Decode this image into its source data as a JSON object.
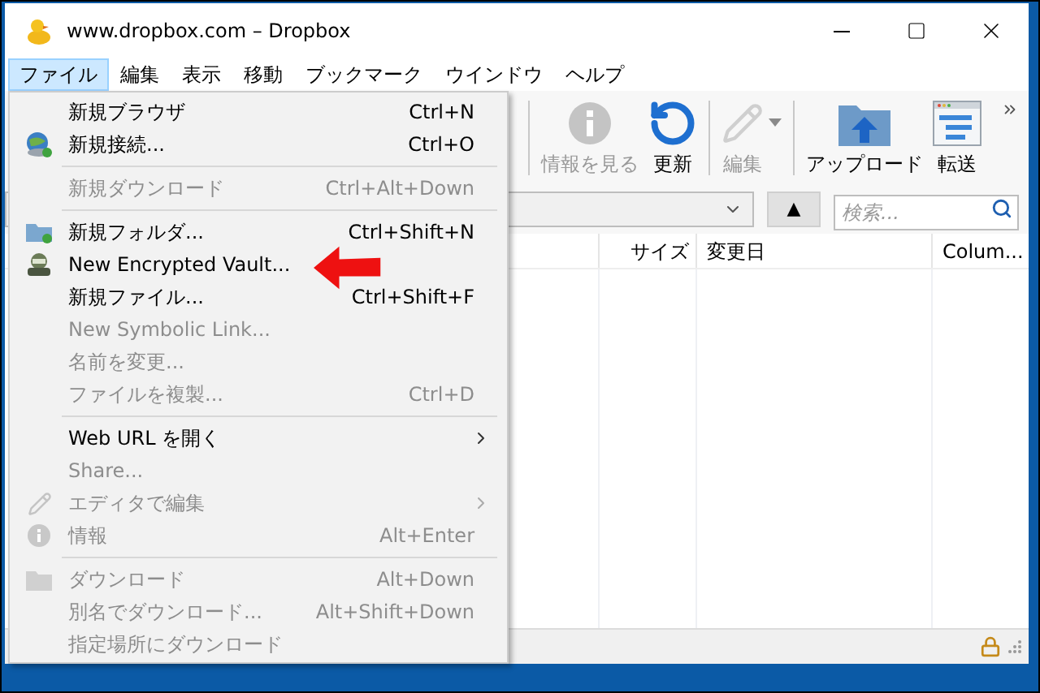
{
  "window": {
    "title": "www.dropbox.com – Dropbox"
  },
  "menu_bar": [
    {
      "label": "ファイル",
      "selected": true
    },
    {
      "label": "編集",
      "selected": false
    },
    {
      "label": "表示",
      "selected": false
    },
    {
      "label": "移動",
      "selected": false
    },
    {
      "label": "ブックマーク",
      "selected": false
    },
    {
      "label": "ウインドウ",
      "selected": false
    },
    {
      "label": "ヘルプ",
      "selected": false
    }
  ],
  "toolbar": [
    {
      "kind": "info",
      "label": "情報を見る",
      "disabled": true,
      "dropdown": false
    },
    {
      "kind": "refresh",
      "label": "更新",
      "disabled": false,
      "dropdown": false
    },
    {
      "kind": "edit",
      "label": "編集",
      "disabled": true,
      "dropdown": true
    },
    {
      "kind": "upload",
      "label": "アップロード",
      "disabled": false,
      "dropdown": false
    },
    {
      "kind": "transfers",
      "label": "転送",
      "disabled": false,
      "dropdown": false
    }
  ],
  "up_button": "▲",
  "search": {
    "placeholder": "検索..."
  },
  "columns": [
    "サイズ",
    "変更日",
    "Colum..."
  ],
  "file_menu": [
    {
      "kind": "plain",
      "label": "新規ブラウザ",
      "shortcut": "Ctrl+N",
      "disabled": false
    },
    {
      "kind": "globe",
      "label": "新規接続...",
      "shortcut": "Ctrl+O",
      "disabled": false
    },
    {
      "kind": "separator"
    },
    {
      "kind": "plain",
      "label": "新規ダウンロード",
      "shortcut": "Ctrl+Alt+Down",
      "disabled": true
    },
    {
      "kind": "separator"
    },
    {
      "kind": "folder",
      "label": "新規フォルダ...",
      "shortcut": "Ctrl+Shift+N",
      "disabled": false
    },
    {
      "kind": "vault",
      "label": "New Encrypted Vault...",
      "disabled": false
    },
    {
      "kind": "plain",
      "label": "新規ファイル...",
      "shortcut": "Ctrl+Shift+F",
      "disabled": false
    },
    {
      "kind": "plain",
      "label": "New Symbolic Link...",
      "disabled": true
    },
    {
      "kind": "plain",
      "label": "名前を変更...",
      "disabled": true
    },
    {
      "kind": "plain",
      "label": "ファイルを複製...",
      "shortcut": "Ctrl+D",
      "disabled": true
    },
    {
      "kind": "separator"
    },
    {
      "kind": "plain",
      "label": "Web URL を開く",
      "disabled": false,
      "submenu": true
    },
    {
      "kind": "plain",
      "label": "Share...",
      "disabled": true
    },
    {
      "kind": "pencil",
      "label": "エディタで編集",
      "disabled": true,
      "submenu": true
    },
    {
      "kind": "info",
      "label": "情報",
      "shortcut": "Alt+Enter",
      "disabled": true
    },
    {
      "kind": "separator"
    },
    {
      "kind": "download",
      "label": "ダウンロード",
      "shortcut": "Alt+Down",
      "disabled": true
    },
    {
      "kind": "plain",
      "label": "別名でダウンロード...",
      "shortcut": "Alt+Shift+Down",
      "disabled": true
    },
    {
      "kind": "plain",
      "label": "指定場所にダウンロード",
      "disabled": true
    }
  ]
}
